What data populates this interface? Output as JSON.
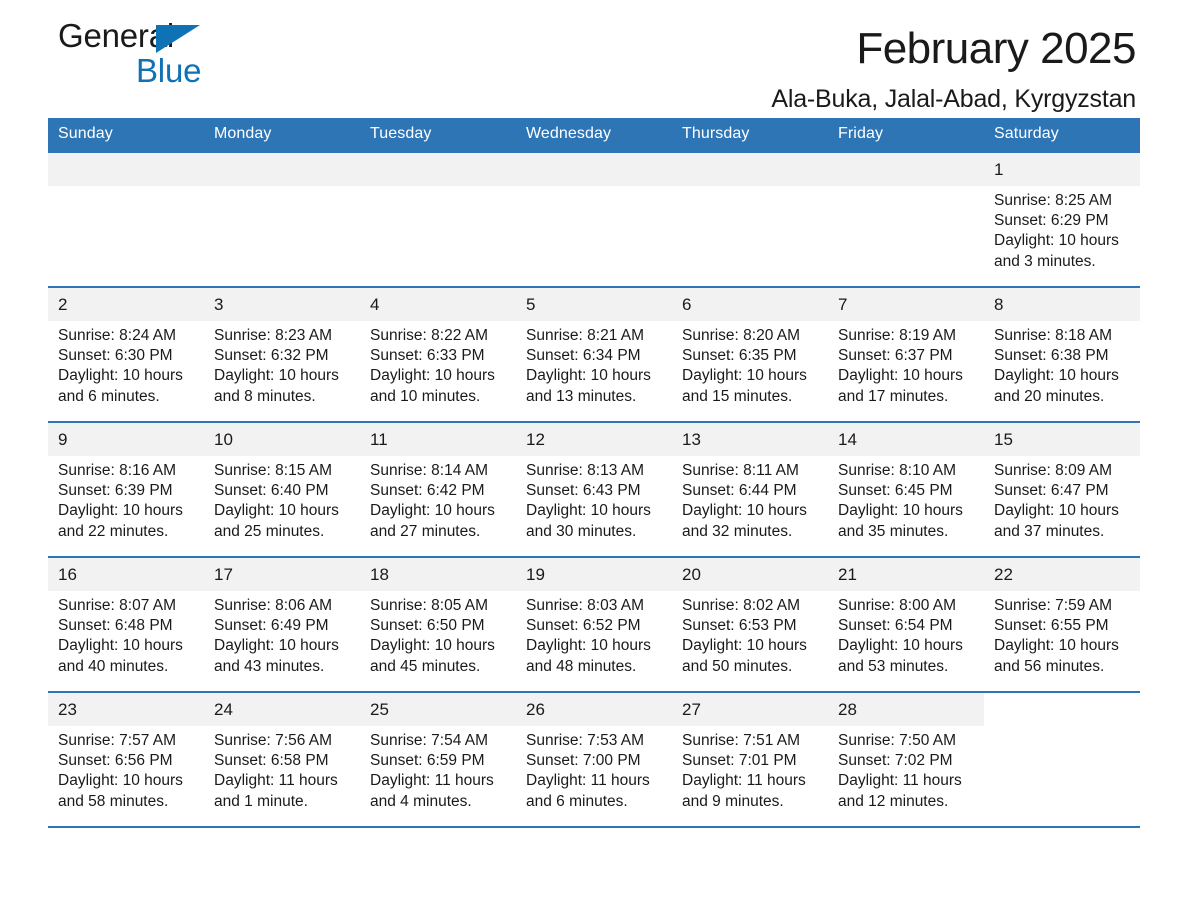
{
  "brand": {
    "name_part1": "General",
    "name_part2": "Blue",
    "triangle_color": "#0f72b5"
  },
  "header": {
    "month_title": "February 2025",
    "location": "Ala-Buka, Jalal-Abad, Kyrgyzstan"
  },
  "theme": {
    "header_blue": "#2e75b6",
    "row_divider": "#2e75b6",
    "daynum_band": "#f2f2f2"
  },
  "weekdays": [
    "Sunday",
    "Monday",
    "Tuesday",
    "Wednesday",
    "Thursday",
    "Friday",
    "Saturday"
  ],
  "labels": {
    "sunrise_prefix": "Sunrise:",
    "sunset_prefix": "Sunset:",
    "daylight_prefix": "Daylight:"
  },
  "weeks": [
    [
      {
        "day": "",
        "empty": true
      },
      {
        "day": "",
        "empty": true
      },
      {
        "day": "",
        "empty": true
      },
      {
        "day": "",
        "empty": true
      },
      {
        "day": "",
        "empty": true
      },
      {
        "day": "",
        "empty": true
      },
      {
        "day": "1",
        "sunrise": "Sunrise: 8:25 AM",
        "sunset": "Sunset: 6:29 PM",
        "daylight": "Daylight: 10 hours and 3 minutes."
      }
    ],
    [
      {
        "day": "2",
        "sunrise": "Sunrise: 8:24 AM",
        "sunset": "Sunset: 6:30 PM",
        "daylight": "Daylight: 10 hours and 6 minutes."
      },
      {
        "day": "3",
        "sunrise": "Sunrise: 8:23 AM",
        "sunset": "Sunset: 6:32 PM",
        "daylight": "Daylight: 10 hours and 8 minutes."
      },
      {
        "day": "4",
        "sunrise": "Sunrise: 8:22 AM",
        "sunset": "Sunset: 6:33 PM",
        "daylight": "Daylight: 10 hours and 10 minutes."
      },
      {
        "day": "5",
        "sunrise": "Sunrise: 8:21 AM",
        "sunset": "Sunset: 6:34 PM",
        "daylight": "Daylight: 10 hours and 13 minutes."
      },
      {
        "day": "6",
        "sunrise": "Sunrise: 8:20 AM",
        "sunset": "Sunset: 6:35 PM",
        "daylight": "Daylight: 10 hours and 15 minutes."
      },
      {
        "day": "7",
        "sunrise": "Sunrise: 8:19 AM",
        "sunset": "Sunset: 6:37 PM",
        "daylight": "Daylight: 10 hours and 17 minutes."
      },
      {
        "day": "8",
        "sunrise": "Sunrise: 8:18 AM",
        "sunset": "Sunset: 6:38 PM",
        "daylight": "Daylight: 10 hours and 20 minutes."
      }
    ],
    [
      {
        "day": "9",
        "sunrise": "Sunrise: 8:16 AM",
        "sunset": "Sunset: 6:39 PM",
        "daylight": "Daylight: 10 hours and 22 minutes."
      },
      {
        "day": "10",
        "sunrise": "Sunrise: 8:15 AM",
        "sunset": "Sunset: 6:40 PM",
        "daylight": "Daylight: 10 hours and 25 minutes."
      },
      {
        "day": "11",
        "sunrise": "Sunrise: 8:14 AM",
        "sunset": "Sunset: 6:42 PM",
        "daylight": "Daylight: 10 hours and 27 minutes."
      },
      {
        "day": "12",
        "sunrise": "Sunrise: 8:13 AM",
        "sunset": "Sunset: 6:43 PM",
        "daylight": "Daylight: 10 hours and 30 minutes."
      },
      {
        "day": "13",
        "sunrise": "Sunrise: 8:11 AM",
        "sunset": "Sunset: 6:44 PM",
        "daylight": "Daylight: 10 hours and 32 minutes."
      },
      {
        "day": "14",
        "sunrise": "Sunrise: 8:10 AM",
        "sunset": "Sunset: 6:45 PM",
        "daylight": "Daylight: 10 hours and 35 minutes."
      },
      {
        "day": "15",
        "sunrise": "Sunrise: 8:09 AM",
        "sunset": "Sunset: 6:47 PM",
        "daylight": "Daylight: 10 hours and 37 minutes."
      }
    ],
    [
      {
        "day": "16",
        "sunrise": "Sunrise: 8:07 AM",
        "sunset": "Sunset: 6:48 PM",
        "daylight": "Daylight: 10 hours and 40 minutes."
      },
      {
        "day": "17",
        "sunrise": "Sunrise: 8:06 AM",
        "sunset": "Sunset: 6:49 PM",
        "daylight": "Daylight: 10 hours and 43 minutes."
      },
      {
        "day": "18",
        "sunrise": "Sunrise: 8:05 AM",
        "sunset": "Sunset: 6:50 PM",
        "daylight": "Daylight: 10 hours and 45 minutes."
      },
      {
        "day": "19",
        "sunrise": "Sunrise: 8:03 AM",
        "sunset": "Sunset: 6:52 PM",
        "daylight": "Daylight: 10 hours and 48 minutes."
      },
      {
        "day": "20",
        "sunrise": "Sunrise: 8:02 AM",
        "sunset": "Sunset: 6:53 PM",
        "daylight": "Daylight: 10 hours and 50 minutes."
      },
      {
        "day": "21",
        "sunrise": "Sunrise: 8:00 AM",
        "sunset": "Sunset: 6:54 PM",
        "daylight": "Daylight: 10 hours and 53 minutes."
      },
      {
        "day": "22",
        "sunrise": "Sunrise: 7:59 AM",
        "sunset": "Sunset: 6:55 PM",
        "daylight": "Daylight: 10 hours and 56 minutes."
      }
    ],
    [
      {
        "day": "23",
        "sunrise": "Sunrise: 7:57 AM",
        "sunset": "Sunset: 6:56 PM",
        "daylight": "Daylight: 10 hours and 58 minutes."
      },
      {
        "day": "24",
        "sunrise": "Sunrise: 7:56 AM",
        "sunset": "Sunset: 6:58 PM",
        "daylight": "Daylight: 11 hours and 1 minute."
      },
      {
        "day": "25",
        "sunrise": "Sunrise: 7:54 AM",
        "sunset": "Sunset: 6:59 PM",
        "daylight": "Daylight: 11 hours and 4 minutes."
      },
      {
        "day": "26",
        "sunrise": "Sunrise: 7:53 AM",
        "sunset": "Sunset: 7:00 PM",
        "daylight": "Daylight: 11 hours and 6 minutes."
      },
      {
        "day": "27",
        "sunrise": "Sunrise: 7:51 AM",
        "sunset": "Sunset: 7:01 PM",
        "daylight": "Daylight: 11 hours and 9 minutes."
      },
      {
        "day": "28",
        "sunrise": "Sunrise: 7:50 AM",
        "sunset": "Sunset: 7:02 PM",
        "daylight": "Daylight: 11 hours and 12 minutes."
      },
      {
        "day": "",
        "blank": true
      }
    ]
  ]
}
